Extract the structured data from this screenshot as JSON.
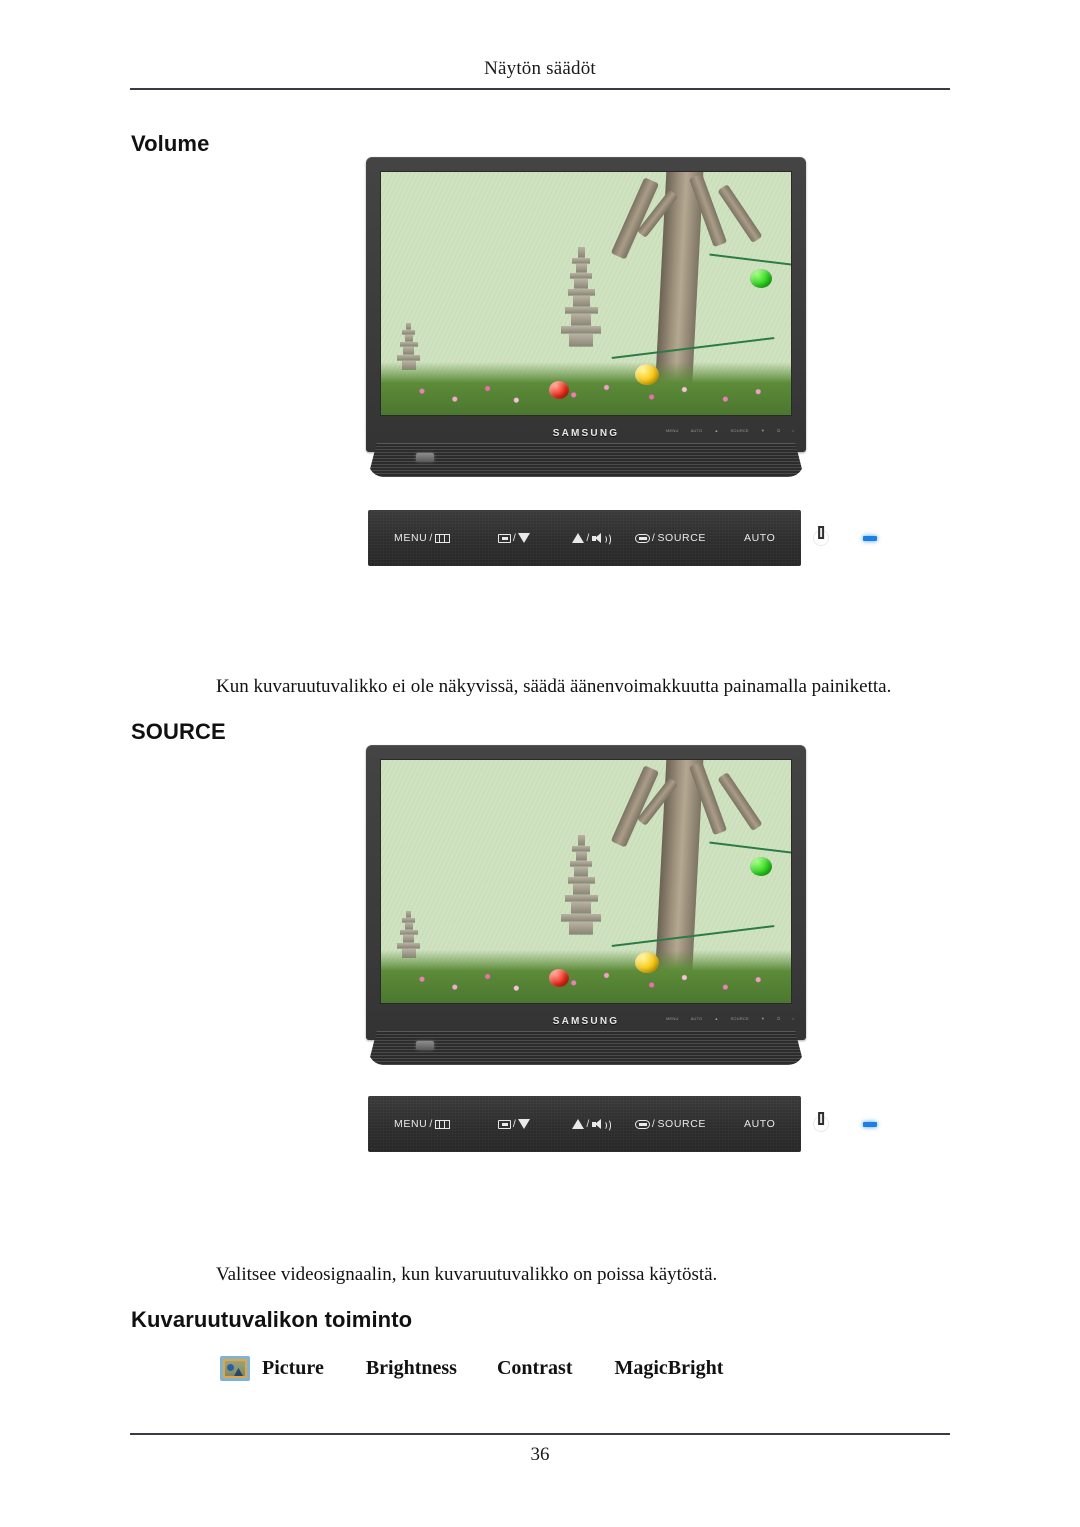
{
  "document": {
    "header_title": "Näytön säädöt",
    "page_number": "36"
  },
  "sections": {
    "volume": {
      "heading": "Volume",
      "description": "Kun kuvaruutuvalikko ei ole näkyvissä, säädä äänenvoimakkuutta painamalla painiketta."
    },
    "source": {
      "heading": "SOURCE",
      "description": "Valitsee videosignaalin, kun kuvaruutuvalikko on poissa käytöstä."
    },
    "osd": {
      "heading": "Kuvaruutuvalikon toiminto",
      "items": [
        {
          "label": "Picture",
          "icon": "picture-icon"
        },
        {
          "label": "Brightness"
        },
        {
          "label": "Contrast"
        },
        {
          "label": "MagicBright"
        }
      ]
    }
  },
  "monitor": {
    "brand": "SAMSUNG",
    "bezel_marks": [
      "MENU",
      "AUTO",
      "▲",
      "SOURCE",
      "▼",
      "⏻",
      "•"
    ],
    "screen_content": "garden photo with stone pagodas, trees and hanging lanterns"
  },
  "control_panel": {
    "buttons": [
      {
        "name": "menu-button",
        "label": "MENU",
        "icon": "menu-bars-icon"
      },
      {
        "name": "down-button",
        "label": "",
        "icon": "enter-icon",
        "icon2": "triangle-down-icon"
      },
      {
        "name": "up-volume-button",
        "label": "",
        "icon": "triangle-up-icon",
        "icon2": "speaker-icon"
      },
      {
        "name": "source-button",
        "label": "SOURCE",
        "icon": "enter-rounded-icon"
      },
      {
        "name": "auto-button",
        "label": "AUTO"
      },
      {
        "name": "power-button",
        "label": "",
        "icon": "power-icon"
      },
      {
        "name": "power-led",
        "label": "",
        "icon": "led-indicator"
      }
    ],
    "separator": "/"
  },
  "colors": {
    "panel_bg": "#2e2e2e",
    "bezel": "#3c3c3c",
    "led": "#1d7fe0",
    "icon_accent": "#e8a33c",
    "icon_frame": "#7fb3d6",
    "rule": "#3a3a46"
  }
}
